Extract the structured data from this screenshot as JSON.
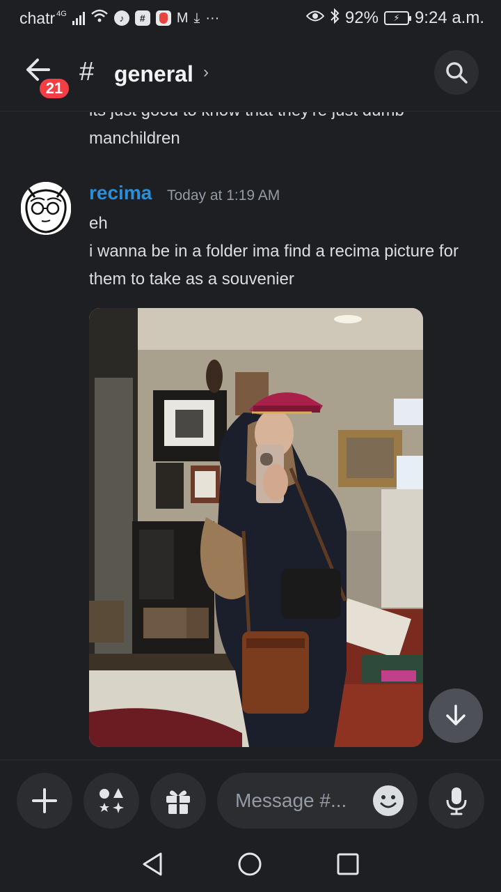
{
  "status_bar": {
    "carrier": "chatr",
    "network": "4G",
    "battery": "92%",
    "time": "9:24 a.m."
  },
  "header": {
    "back_icon": "arrow-left-icon",
    "unread_badge": "21",
    "channel_prefix": "#",
    "channel_name": "general",
    "chevron": "›",
    "search_icon": "search-icon"
  },
  "messages": {
    "previous_cut": "its just good to know that they're just dumb",
    "previous_tail": "manchildren",
    "author": "recima",
    "timestamp": "Today at 1:19 AM",
    "lines": [
      "eh",
      "i wanna be in a folder ima find a recima picture for them to take as a souvenier"
    ]
  },
  "composer": {
    "placeholder": "Message #...",
    "buttons": [
      "plus-icon",
      "apps-icon",
      "gift-icon",
      "emoji-icon",
      "microphone-icon"
    ]
  },
  "colors": {
    "background": "#1e1f22",
    "author": "#2b8ed6",
    "badge": "#f23f43"
  }
}
